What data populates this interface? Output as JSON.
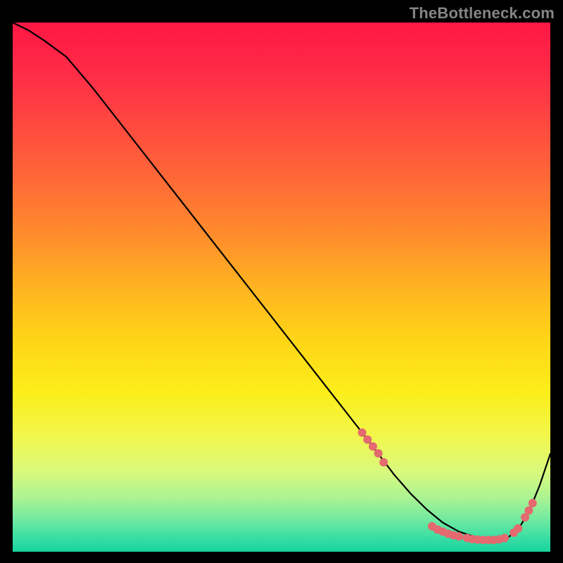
{
  "watermark": "TheBottleneck.com",
  "chart_data": {
    "type": "line",
    "title": "",
    "xlabel": "",
    "ylabel": "",
    "xlim": [
      0,
      100
    ],
    "ylim": [
      0,
      100
    ],
    "background_gradient": {
      "stops": [
        {
          "offset": 0.0,
          "color": "#ff1744"
        },
        {
          "offset": 0.1,
          "color": "#ff2d47"
        },
        {
          "offset": 0.2,
          "color": "#ff4b3f"
        },
        {
          "offset": 0.3,
          "color": "#ff6a36"
        },
        {
          "offset": 0.4,
          "color": "#ff8c2c"
        },
        {
          "offset": 0.5,
          "color": "#ffb321"
        },
        {
          "offset": 0.6,
          "color": "#ffd516"
        },
        {
          "offset": 0.7,
          "color": "#fbee1a"
        },
        {
          "offset": 0.78,
          "color": "#f2f74b"
        },
        {
          "offset": 0.85,
          "color": "#d8f97d"
        },
        {
          "offset": 0.9,
          "color": "#a9f393"
        },
        {
          "offset": 0.94,
          "color": "#6fe9a0"
        },
        {
          "offset": 0.97,
          "color": "#3fdfa4"
        },
        {
          "offset": 1.0,
          "color": "#17d49d"
        }
      ]
    },
    "series": [
      {
        "name": "curve",
        "color": "#000000",
        "stroke_width": 2.2,
        "x": [
          0,
          3,
          6,
          10,
          15,
          20,
          25,
          30,
          35,
          40,
          45,
          50,
          55,
          60,
          65,
          68,
          71,
          74,
          77,
          80,
          83,
          86,
          88,
          90,
          92,
          94,
          96,
          98,
          100
        ],
        "y": [
          100,
          98.5,
          96.5,
          93.5,
          87.5,
          81,
          74.5,
          68,
          61.5,
          55,
          48.5,
          42,
          35.5,
          29,
          22.5,
          18.5,
          14.5,
          11,
          8,
          5.5,
          3.8,
          2.8,
          2.3,
          2.2,
          2.6,
          4.2,
          7.5,
          12.5,
          18.5
        ]
      }
    ],
    "markers": {
      "color": "#e46a6f",
      "radius": 6,
      "points_xy": [
        [
          65,
          22.5
        ],
        [
          66,
          21.2
        ],
        [
          67,
          19.9
        ],
        [
          68,
          18.6
        ],
        [
          69,
          16.9
        ],
        [
          78,
          4.8
        ],
        [
          79,
          4.2
        ],
        [
          80,
          3.8
        ],
        [
          81,
          3.4
        ],
        [
          82,
          3.1
        ],
        [
          83,
          2.9
        ],
        [
          84.5,
          2.6
        ],
        [
          85.5,
          2.4
        ],
        [
          86.5,
          2.3
        ],
        [
          87.5,
          2.25
        ],
        [
          88.5,
          2.22
        ],
        [
          89.5,
          2.25
        ],
        [
          90.5,
          2.35
        ],
        [
          91.5,
          2.6
        ],
        [
          93.2,
          3.6
        ],
        [
          94.0,
          4.4
        ],
        [
          95.3,
          6.5
        ],
        [
          96.0,
          7.8
        ],
        [
          96.7,
          9.2
        ]
      ]
    }
  }
}
